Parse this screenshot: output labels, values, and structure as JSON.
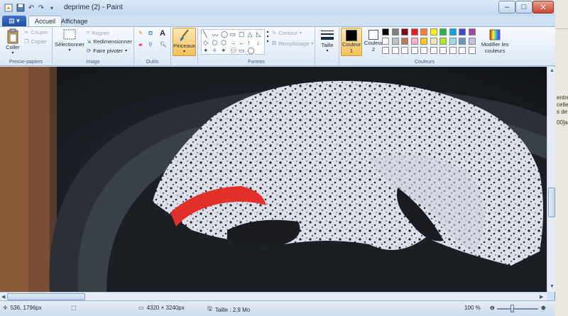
{
  "window": {
    "title": "deprime (2) - Paint",
    "controls": {
      "minimize": "–",
      "maximize": "□",
      "close": "✕"
    }
  },
  "tabs": [
    {
      "label": "Accueil",
      "active": true
    },
    {
      "label": "Affichage",
      "active": false
    }
  ],
  "ribbon": {
    "clipboard": {
      "group_label": "Presse-papiers",
      "paste": "Coller",
      "cut": "Couper",
      "copy": "Copier"
    },
    "image": {
      "group_label": "Image",
      "select": "Sélectionner",
      "crop": "Rogner",
      "resize": "Redimensionner",
      "rotate": "Faire pivoter"
    },
    "tools": {
      "group_label": "Outils"
    },
    "brushes": {
      "label": "Pinceaux"
    },
    "shapes": {
      "group_label": "Formes",
      "outline": "Contour",
      "fill": "Remplissage"
    },
    "size": {
      "label": "Taille"
    },
    "colors": {
      "group_label": "Couleurs",
      "color1": "Couleur 1",
      "color2": "Couleur 2",
      "edit": "Modifier les couleurs",
      "color1_value": "#000000",
      "color2_value": "#ffffff",
      "palette_row1": [
        "#000000",
        "#7f7f7f",
        "#880015",
        "#ed1c24",
        "#ff7f27",
        "#fff200",
        "#22b14c",
        "#00a2e8",
        "#3f48cc",
        "#a349a4"
      ],
      "palette_row2": [
        "#ffffff",
        "#c3c3c3",
        "#b97a57",
        "#ffaec9",
        "#ffc90e",
        "#efe4b0",
        "#b5e61d",
        "#99d9ea",
        "#7092be",
        "#c8bfe7"
      ],
      "palette_row3": [
        "#ffffff",
        "#ffffff",
        "#ffffff",
        "#ffffff",
        "#ffffff",
        "#ffffff",
        "#ffffff",
        "#ffffff",
        "#ffffff",
        "#ffffff"
      ]
    }
  },
  "status": {
    "cursor_pos": "536, 1796px",
    "image_size": "4320 × 3240px",
    "file_size": "Taille : 2,9 Mo",
    "zoom": "100 %"
  },
  "behind_text": [
    "entre",
    "celle",
    "s de",
    "00]a"
  ]
}
